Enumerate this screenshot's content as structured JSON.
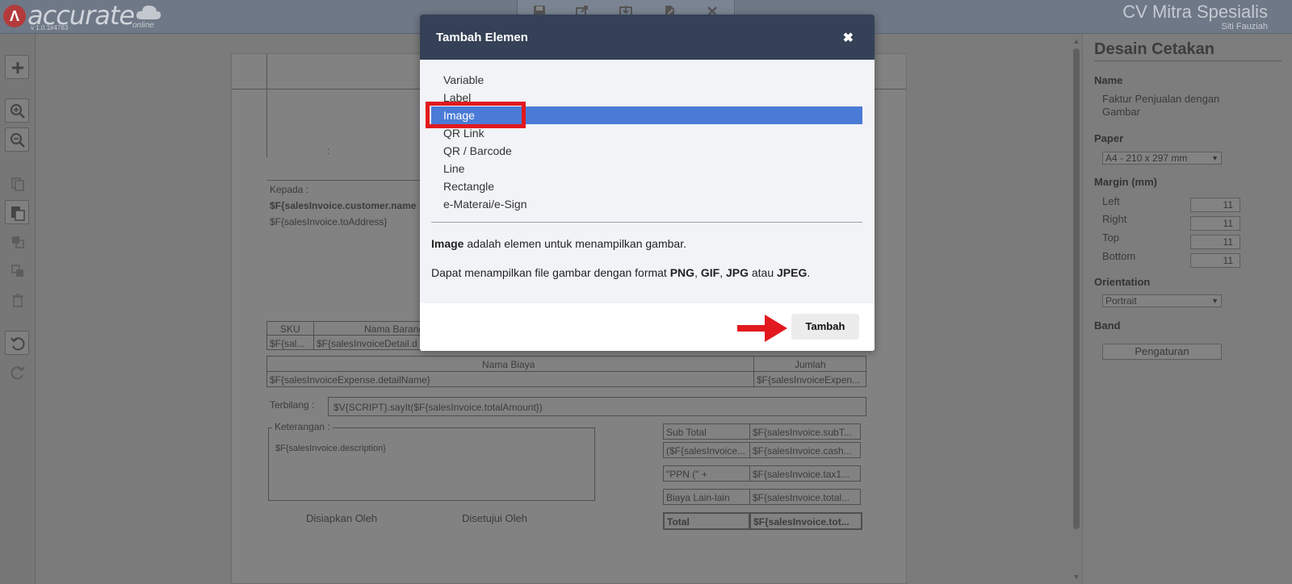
{
  "header": {
    "logo_text": "accurate",
    "logo_online": "online",
    "version": "v 1.0.1#4763",
    "company": "CV Mitra Spesialis",
    "user": "Siti Fauziah"
  },
  "document": {
    "colon": ":",
    "kepada_label": "Kepada :",
    "customer_name": "$F{salesInvoice.customer.name",
    "to_address": "$F{salesInvoice.toAddress}",
    "items_headers": [
      "SKU",
      "Nama Barang"
    ],
    "items_row": [
      "$F{sal...",
      "$F{salesInvoiceDetail.d"
    ],
    "expense_headers": [
      "Nama Biaya",
      "Jumlah"
    ],
    "expense_row": [
      "$F{salesInvoiceExpense.detailName}",
      "$F{salesInvoiceExpen..."
    ],
    "terbilang_label": "Terbilang :",
    "terbilang_value": "$V{SCRIPT}.sayIt($F{salesInvoice.totalAmount})",
    "keterangan_label": "Keterangan :",
    "keterangan_value": "$F{salesInvoice.description}",
    "prepared_by": "Disiapkan Oleh",
    "approved_by": "Disetujui Oleh",
    "totals": [
      {
        "label": "Sub Total",
        "value": "$F{salesInvoice.subT..."
      },
      {
        "label": "($F{salesInvoice...",
        "value": "$F{salesInvoice.cash..."
      },
      {
        "label": "\"PPN (\" +",
        "value": "$F{salesInvoice.tax1..."
      },
      {
        "label": "Biaya Lain-lain",
        "value": "$F{salesInvoice.total..."
      },
      {
        "label": "Total",
        "value": "$F{salesInvoice.tot..."
      }
    ]
  },
  "right_panel": {
    "title": "Desain Cetakan",
    "name_label": "Name",
    "name_value": "Faktur Penjualan dengan Gambar",
    "paper_label": "Paper",
    "paper_value": "A4 - 210 x 297 mm",
    "margin_label": "Margin (mm)",
    "margins": [
      {
        "label": "Left",
        "value": "11"
      },
      {
        "label": "Right",
        "value": "11"
      },
      {
        "label": "Top",
        "value": "11"
      },
      {
        "label": "Bottom",
        "value": "11"
      }
    ],
    "orientation_label": "Orientation",
    "orientation_value": "Portrait",
    "band_label": "Band",
    "band_button": "Pengaturan"
  },
  "modal": {
    "title": "Tambah Elemen",
    "close": "✖",
    "items": [
      "Variable",
      "Label",
      "Image",
      "QR Link",
      "QR / Barcode",
      "Line",
      "Rectangle",
      "e-Materai/e-Sign"
    ],
    "selected_index": 2,
    "desc_bold": "Image",
    "desc_rest": " adalah elemen untuk menampilkan gambar.",
    "formats_prefix": "Dapat menampilkan file gambar dengan format ",
    "formats": [
      "PNG",
      "GIF",
      "JPG",
      "JPEG"
    ],
    "formats_sep1": ", ",
    "formats_sep2": " atau ",
    "formats_end": ".",
    "add_button": "Tambah"
  },
  "colors": {
    "modal_header": "#344157",
    "selected": "#4a7bd6",
    "highlight": "#e2191e"
  }
}
